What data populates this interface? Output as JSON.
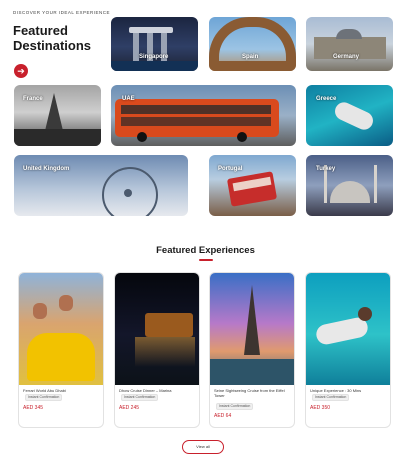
{
  "header": {
    "eyebrow": "DISCOVER YOUR IDEAL EXPERIENCE",
    "title_line1": "Featured",
    "title_line2": "Destinations",
    "arrow_icon": "arrow-right-icon"
  },
  "destinations": [
    {
      "label": "Singapore"
    },
    {
      "label": "Spain"
    },
    {
      "label": "Germany"
    },
    {
      "label": "France"
    },
    {
      "label": "UAE"
    },
    {
      "label": "Greece"
    },
    {
      "label": "United Kingdom"
    },
    {
      "label": "Portugal"
    },
    {
      "label": "Turkey"
    }
  ],
  "experiences_section": {
    "title": "Featured Experiences",
    "view_all_label": "View all"
  },
  "experiences": [
    {
      "name": "Ferrari World Abu Dhabi",
      "badge": "Instant Confirmation",
      "price": "AED 345"
    },
    {
      "name": "Dhow Cruise Dinner – Marina",
      "badge": "Instant Confirmation",
      "price": "AED 245"
    },
    {
      "name": "Seine Sightseeing Cruise from the Eiffel Tower",
      "badge": "Instant Confirmation",
      "price": "AED 64"
    },
    {
      "name": "Unique Experience : 30 Mins",
      "badge": "Instant Confirmation",
      "price": "AED 350"
    }
  ],
  "colors": {
    "accent": "#c8202c"
  }
}
